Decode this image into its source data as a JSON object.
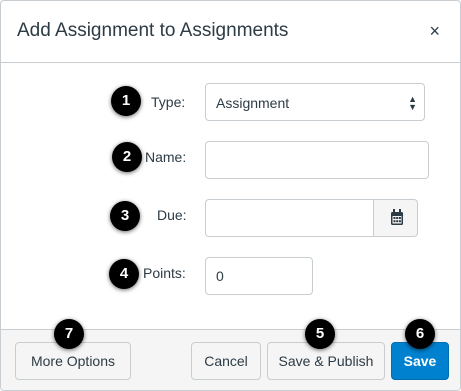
{
  "dialog": {
    "title": "Add Assignment to Assignments",
    "close_glyph": "×"
  },
  "form": {
    "type_label": "Type:",
    "type_value": "Assignment",
    "name_label": "Name:",
    "name_value": "",
    "due_label": "Due:",
    "due_value": "",
    "points_label": "Points:",
    "points_value": "0"
  },
  "icons": {
    "select_arrows": "select-arrows-icon",
    "calendar": "calendar-icon",
    "close": "close-icon"
  },
  "footer": {
    "more_options_label": "More Options",
    "cancel_label": "Cancel",
    "save_publish_label": "Save & Publish",
    "save_label": "Save"
  },
  "callouts": [
    "1",
    "2",
    "3",
    "4",
    "5",
    "6",
    "7"
  ],
  "colors": {
    "primary": "#0081cf",
    "text": "#2d3b45",
    "border": "#c7cdd1",
    "footer_bg": "#f5f5f5",
    "badge": "#000000"
  }
}
